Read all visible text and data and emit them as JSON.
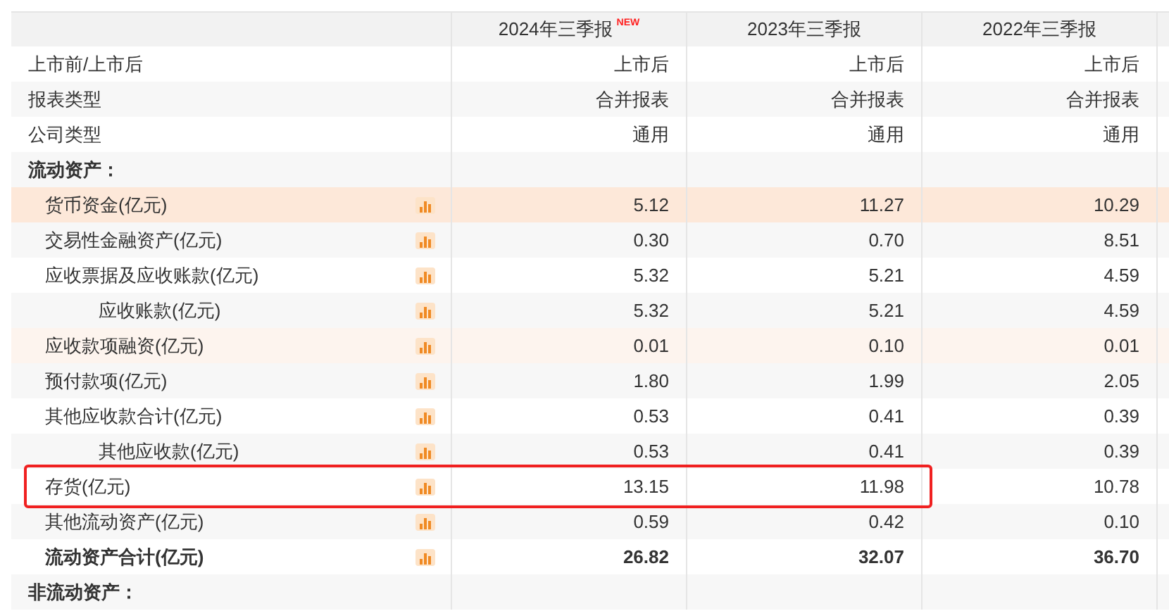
{
  "table": {
    "columns": [
      {
        "label": "2024年三季报",
        "badge": "NEW"
      },
      {
        "label": "2023年三季报"
      },
      {
        "label": "2022年三季报"
      }
    ],
    "rows": [
      {
        "label": "上市前/上市后",
        "values": [
          "上市后",
          "上市后",
          "上市后"
        ],
        "bold": false,
        "chart": false,
        "boxed": false
      },
      {
        "label": "报表类型",
        "values": [
          "合并报表",
          "合并报表",
          "合并报表"
        ],
        "bold": false,
        "chart": false,
        "boxed": false
      },
      {
        "label": "公司类型",
        "values": [
          "通用",
          "通用",
          "通用"
        ],
        "bold": false,
        "chart": false,
        "boxed": false
      },
      {
        "label": "流动资产：",
        "values": [],
        "bold": true,
        "chart": false,
        "boxed": false,
        "children": [
          {
            "label": "货币资金(亿元)",
            "values": [
              "5.12",
              "11.27",
              "10.29"
            ],
            "bold": false,
            "chart": true,
            "boxed": false,
            "color": "#fde8d9"
          },
          {
            "label": "交易性金融资产(亿元)",
            "values": [
              "0.30",
              "0.70",
              "8.51"
            ],
            "bold": false,
            "chart": true,
            "boxed": false
          },
          {
            "label": "应收票据及应收账款(亿元)",
            "values": [
              "5.32",
              "5.21",
              "4.59"
            ],
            "bold": false,
            "chart": true,
            "boxed": false,
            "children": [
              {
                "label": "应收账款(亿元)",
                "values": [
                  "5.32",
                  "5.21",
                  "4.59"
                ],
                "bold": false,
                "chart": true,
                "boxed": false
              }
            ]
          },
          {
            "label": "应收款项融资(亿元)",
            "values": [
              "0.01",
              "0.10",
              "0.01"
            ],
            "bold": false,
            "chart": true,
            "boxed": false,
            "color": "#fdf4ee"
          },
          {
            "label": "预付款项(亿元)",
            "values": [
              "1.80",
              "1.99",
              "2.05"
            ],
            "bold": false,
            "chart": true,
            "boxed": false
          },
          {
            "label": "其他应收款合计(亿元)",
            "values": [
              "0.53",
              "0.41",
              "0.39"
            ],
            "bold": false,
            "chart": true,
            "boxed": false,
            "children": [
              {
                "label": "其他应收款(亿元)",
                "values": [
                  "0.53",
                  "0.41",
                  "0.39"
                ],
                "bold": false,
                "chart": true,
                "boxed": false
              }
            ]
          },
          {
            "label": "存货(亿元)",
            "values": [
              "13.15",
              "11.98",
              "10.78"
            ],
            "bold": false,
            "chart": true,
            "boxed": true
          },
          {
            "label": "其他流动资产(亿元)",
            "values": [
              "0.59",
              "0.42",
              "0.10"
            ],
            "bold": false,
            "chart": true,
            "boxed": false
          },
          {
            "label": "流动资产合计(亿元)",
            "values": [
              "26.82",
              "32.07",
              "36.70"
            ],
            "bold": true,
            "chart": true,
            "boxed": false
          }
        ]
      },
      {
        "label": "非流动资产：",
        "values": [],
        "bold": true,
        "chart": false,
        "boxed": false
      }
    ]
  }
}
